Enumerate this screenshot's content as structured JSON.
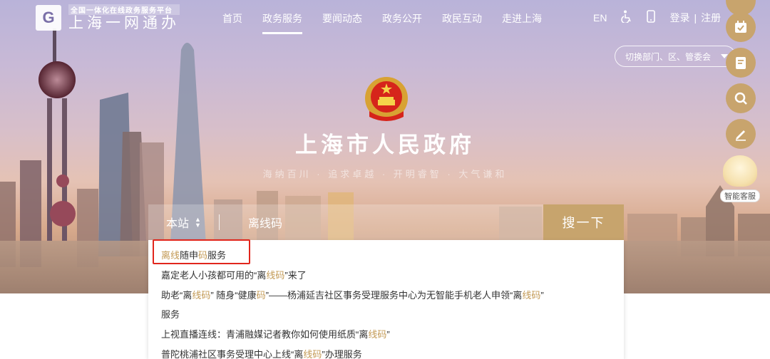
{
  "header": {
    "logo_sub": "全国一体化在线政务服务平台",
    "logo_main": "上海一网通办",
    "logo_mark": "G",
    "nav": [
      "首页",
      "政务服务",
      "要闻动态",
      "政务公开",
      "政民互动",
      "走进上海"
    ],
    "active_nav": "政务服务",
    "lang": "EN",
    "accessibility_icon": "wheelchair-icon",
    "mobile_icon": "mobile-icon",
    "login": "登录",
    "separator": "|",
    "register": "注册"
  },
  "dept_select": {
    "value": "切换部门、区、管委会"
  },
  "floating_toolbar": {
    "icons": [
      "calendar-check-icon",
      "edit-document-icon",
      "search-icon",
      "pen-icon"
    ],
    "service_label": "智能客服",
    "accent": "#c8a46d"
  },
  "hero": {
    "title": "上海市人民政府",
    "slogan": "海纳百川 · 追求卓越 · 开明睿智 · 大气谦和"
  },
  "search": {
    "scope": "本站",
    "query": "离线码",
    "button": "搜一下",
    "button_color": "#c7a46d"
  },
  "suggestions": [
    {
      "parts": [
        [
          "离线",
          true
        ],
        [
          "随申",
          false
        ],
        [
          "码",
          true
        ],
        [
          "服务",
          false
        ]
      ]
    },
    {
      "parts": [
        [
          "嘉定老人小孩都可用的“离",
          false
        ],
        [
          "线码",
          true
        ],
        [
          "”来了",
          false
        ]
      ]
    },
    {
      "parts": [
        [
          "助老“离",
          false
        ],
        [
          "线码",
          true
        ],
        [
          "” 随身“健康",
          false
        ],
        [
          "码",
          true
        ],
        [
          "”——杨浦延吉社区事务受理服务中心为无智能手机老人申领“离",
          false
        ],
        [
          "线码",
          true
        ],
        [
          "”",
          false
        ]
      ]
    },
    {
      "parts": [
        [
          "服务",
          false
        ]
      ]
    },
    {
      "parts": [
        [
          "上视直播连线：青浦融媒记者教你如何使用纸质“离",
          false
        ],
        [
          "线码",
          true
        ],
        [
          "”",
          false
        ]
      ]
    },
    {
      "parts": [
        [
          "普陀桃浦社区事务受理中心上线“离",
          false
        ],
        [
          "线码",
          true
        ],
        [
          "”办理服务",
          false
        ]
      ]
    }
  ],
  "highlight_color": "#e1261c"
}
